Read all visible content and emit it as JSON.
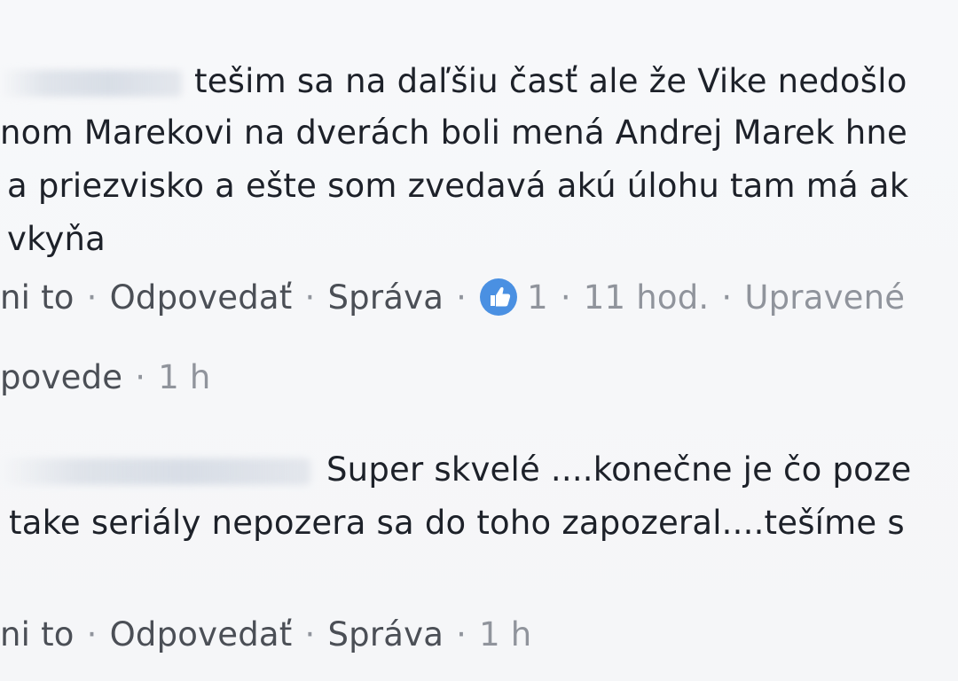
{
  "comment1": {
    "line1": "tešim sa na daľšiu časť ale že Vike nedošlo",
    "line2": "nom Marekovi na dverách boli mená Andrej Marek hne",
    "line3": "a priezvisko a ešte som zvedavá akú úlohu tam má ak",
    "line4": "vkyňa",
    "actions": {
      "like_label": "ni to",
      "reply_label": "Odpovedať",
      "message_label": "Správa",
      "like_count": "1",
      "time": "11 hod.",
      "edited_label": "Upravené"
    }
  },
  "replies": {
    "label": "povede",
    "time": "1 h"
  },
  "comment2": {
    "line1": "Super skvelé ....konečne je čo poze",
    "line2": "take seriály nepozera sa do toho zapozeral....tešíme s",
    "actions": {
      "like_label": "ni to",
      "reply_label": "Odpovedať",
      "message_label": "Správa",
      "time": "1 h"
    }
  },
  "separator": "·",
  "colors": {
    "background": "#f6f7f9",
    "text": "#1d2129",
    "meta": "#90949c",
    "like_blue": "#4a90e2"
  },
  "icons": {
    "like_reaction": "thumbs-up-icon"
  }
}
